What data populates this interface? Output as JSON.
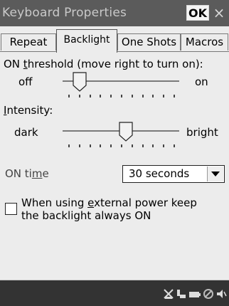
{
  "window": {
    "title": "Keyboard Properties",
    "ok_label": "OK",
    "close_glyph": "×"
  },
  "tabs": [
    {
      "label": "Repeat",
      "active": false
    },
    {
      "label": "Backlight",
      "active": true
    },
    {
      "label": "One Shots",
      "active": false
    },
    {
      "label": "Macros",
      "active": false
    }
  ],
  "backlight": {
    "threshold_label_pre": "ON ",
    "threshold_label_u": "t",
    "threshold_label_post": "hreshold (move right to turn on):",
    "threshold_min_label": "off",
    "threshold_max_label": "on",
    "threshold_value": 0.1,
    "intensity_label_u": "I",
    "intensity_label_post": "ntensity:",
    "intensity_min_label": "dark",
    "intensity_max_label": "bright",
    "intensity_value": 0.55,
    "on_time_label_pre": "ON ti",
    "on_time_label_u": "m",
    "on_time_label_post": "e",
    "on_time_value": "30 seconds",
    "external_power_label_pre": "When using ",
    "external_power_label_u": "e",
    "external_power_label_post": "xternal power keep",
    "external_power_label_line2": "the backlight always ON",
    "external_power_checked": false
  },
  "colors": {
    "titlebar_bg": "#5b5b5b",
    "window_bg": "#ececec",
    "taskbar_bg": "#333333"
  },
  "tray_icons": [
    "network-disconnected-icon",
    "usb-icon",
    "battery-icon",
    "sound-muted-icon",
    "volume-icon"
  ]
}
